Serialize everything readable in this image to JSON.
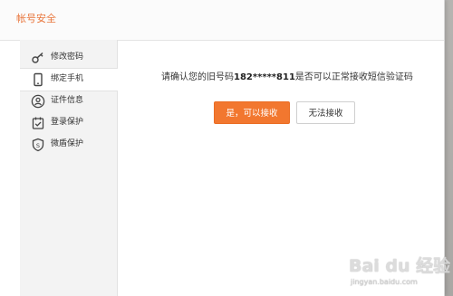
{
  "window": {
    "title": "帐号安全"
  },
  "sidebar": {
    "items": [
      {
        "label": "修改密码",
        "icon": "key-icon",
        "active": false
      },
      {
        "label": "绑定手机",
        "icon": "phone-icon",
        "active": true
      },
      {
        "label": "证件信息",
        "icon": "id-badge-icon",
        "active": false
      },
      {
        "label": "登录保护",
        "icon": "login-protect-icon",
        "active": false
      },
      {
        "label": "微盾保护",
        "icon": "shield-icon",
        "active": false
      }
    ]
  },
  "main": {
    "prompt_prefix": "请确认您的旧号码",
    "masked_number": "182*****811",
    "prompt_suffix": "是否可以正常接收短信验证码",
    "confirm_button": "是，可以接收",
    "reject_button": "无法接收"
  },
  "watermark": {
    "logo_text": "Bai du 经验",
    "url": "jingyan.baidu.com"
  },
  "colors": {
    "accent": "#f2772f",
    "title": "#e9773e",
    "sidebar_bg": "#f3f3f3"
  }
}
